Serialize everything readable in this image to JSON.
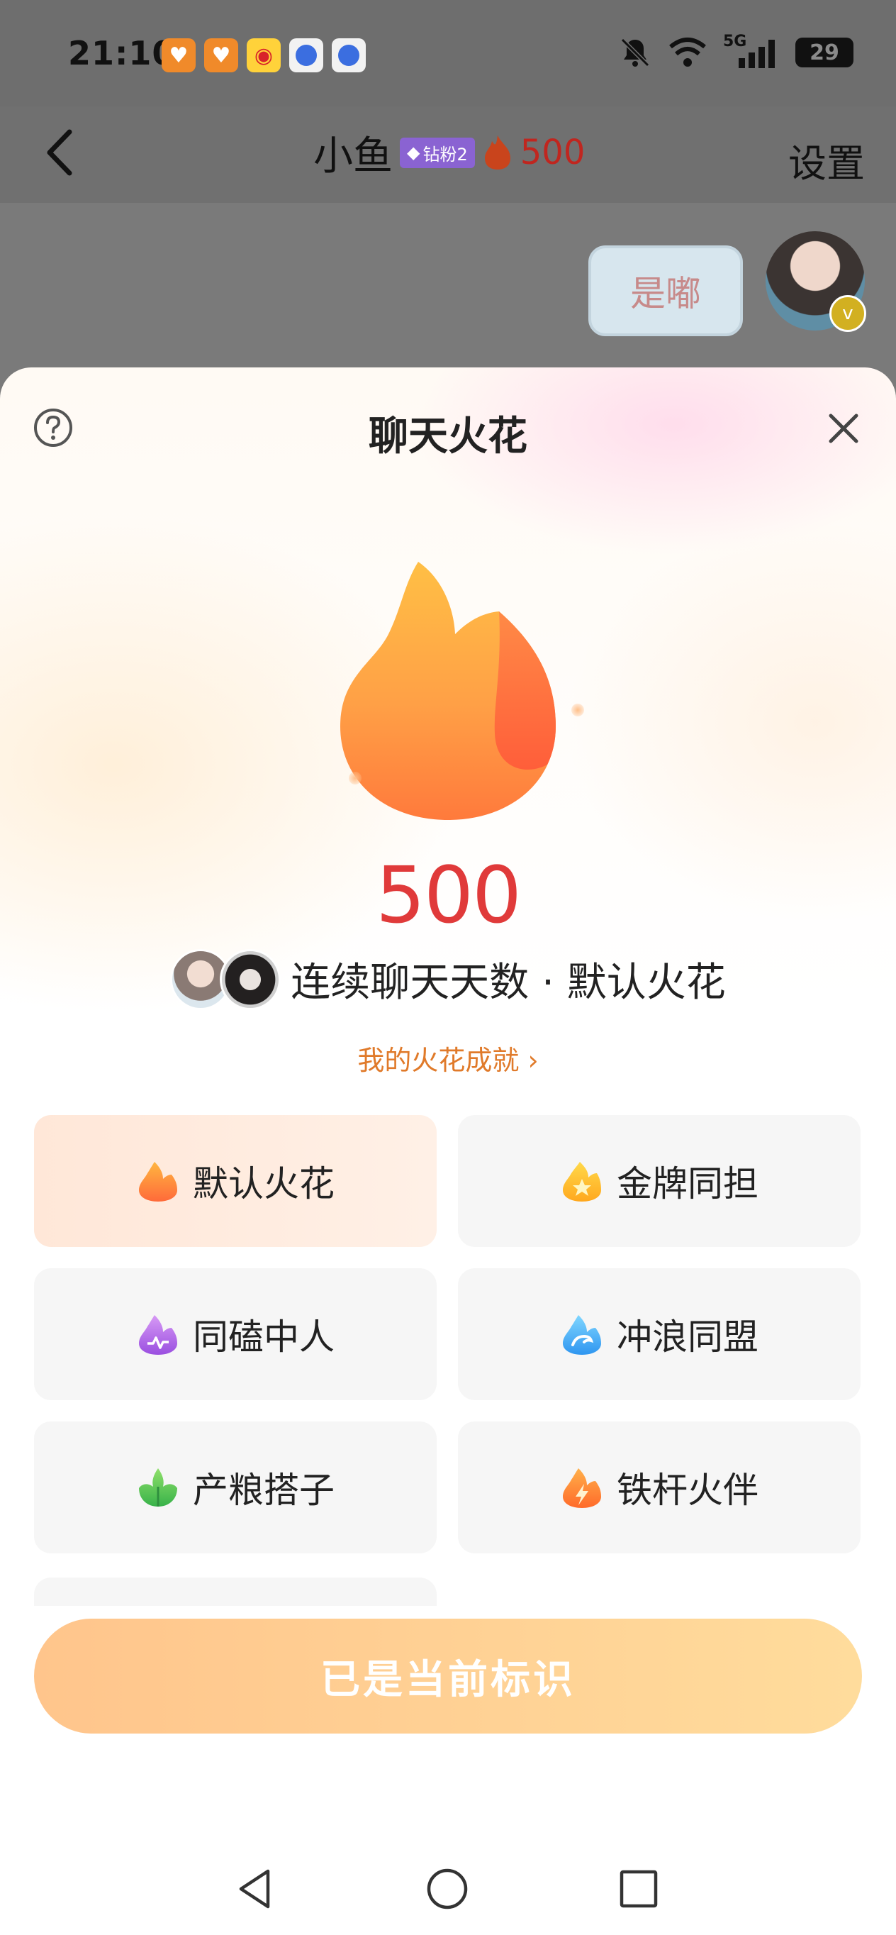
{
  "status_bar": {
    "time": "21:10",
    "network": "5G",
    "battery": "29",
    "app_icons": [
      "heart-app-icon",
      "heart-app-icon",
      "weibo-icon",
      "browser-icon",
      "browser-icon"
    ]
  },
  "chat_header": {
    "name": "小鱼",
    "badge": "钻粉2",
    "spark_count": "500",
    "settings": "设置"
  },
  "chat": {
    "bubble_text": "是嘟"
  },
  "sheet": {
    "title": "聊天火花",
    "count": "500",
    "streak_text": "连续聊天天数 · 默认火花",
    "achievements_link": "我的火花成就 ›",
    "options": [
      {
        "label": "默认火花",
        "icon": "flame-icon",
        "selected": true
      },
      {
        "label": "金牌同担",
        "icon": "gold-star-flame-icon",
        "selected": false
      },
      {
        "label": "同磕中人",
        "icon": "purple-flame-icon",
        "selected": false
      },
      {
        "label": "冲浪同盟",
        "icon": "wave-flame-icon",
        "selected": false
      },
      {
        "label": "产粮搭子",
        "icon": "leaf-flame-icon",
        "selected": false
      },
      {
        "label": "铁杆火伴",
        "icon": "lightning-flame-icon",
        "selected": false
      }
    ],
    "cta": "已是当前标识"
  },
  "colors": {
    "accent_red": "#e03a3a",
    "link_orange": "#e07a2a",
    "cta_gradient_start": "#ffc58c",
    "cta_gradient_end": "#ffdc9c"
  }
}
